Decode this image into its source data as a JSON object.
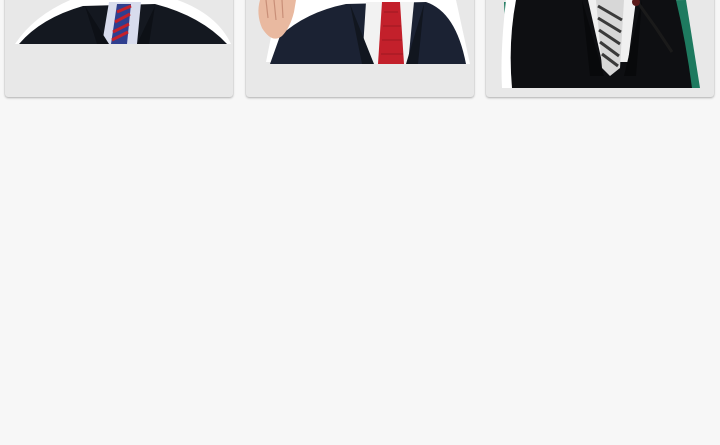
{
  "stickers": [
    {
      "name": "sticker-man-blue-striped-tie",
      "icon": "sticker-portrait-icon",
      "tie_color": "#2f3f8f",
      "accent_color": "#6f6a2a"
    },
    {
      "name": "sticker-man-red-tie-waving",
      "icon": "sticker-portrait-icon",
      "tie_color": "#c3202b",
      "accent_color": "#1b2233"
    },
    {
      "name": "sticker-man-striped-tie-podium",
      "icon": "sticker-portrait-icon",
      "tie_color": "#9a9a9a",
      "accent_color": "#1e7a5f"
    }
  ],
  "colors": {
    "background": "#f7f7f7",
    "card": "#e8e8e8"
  }
}
